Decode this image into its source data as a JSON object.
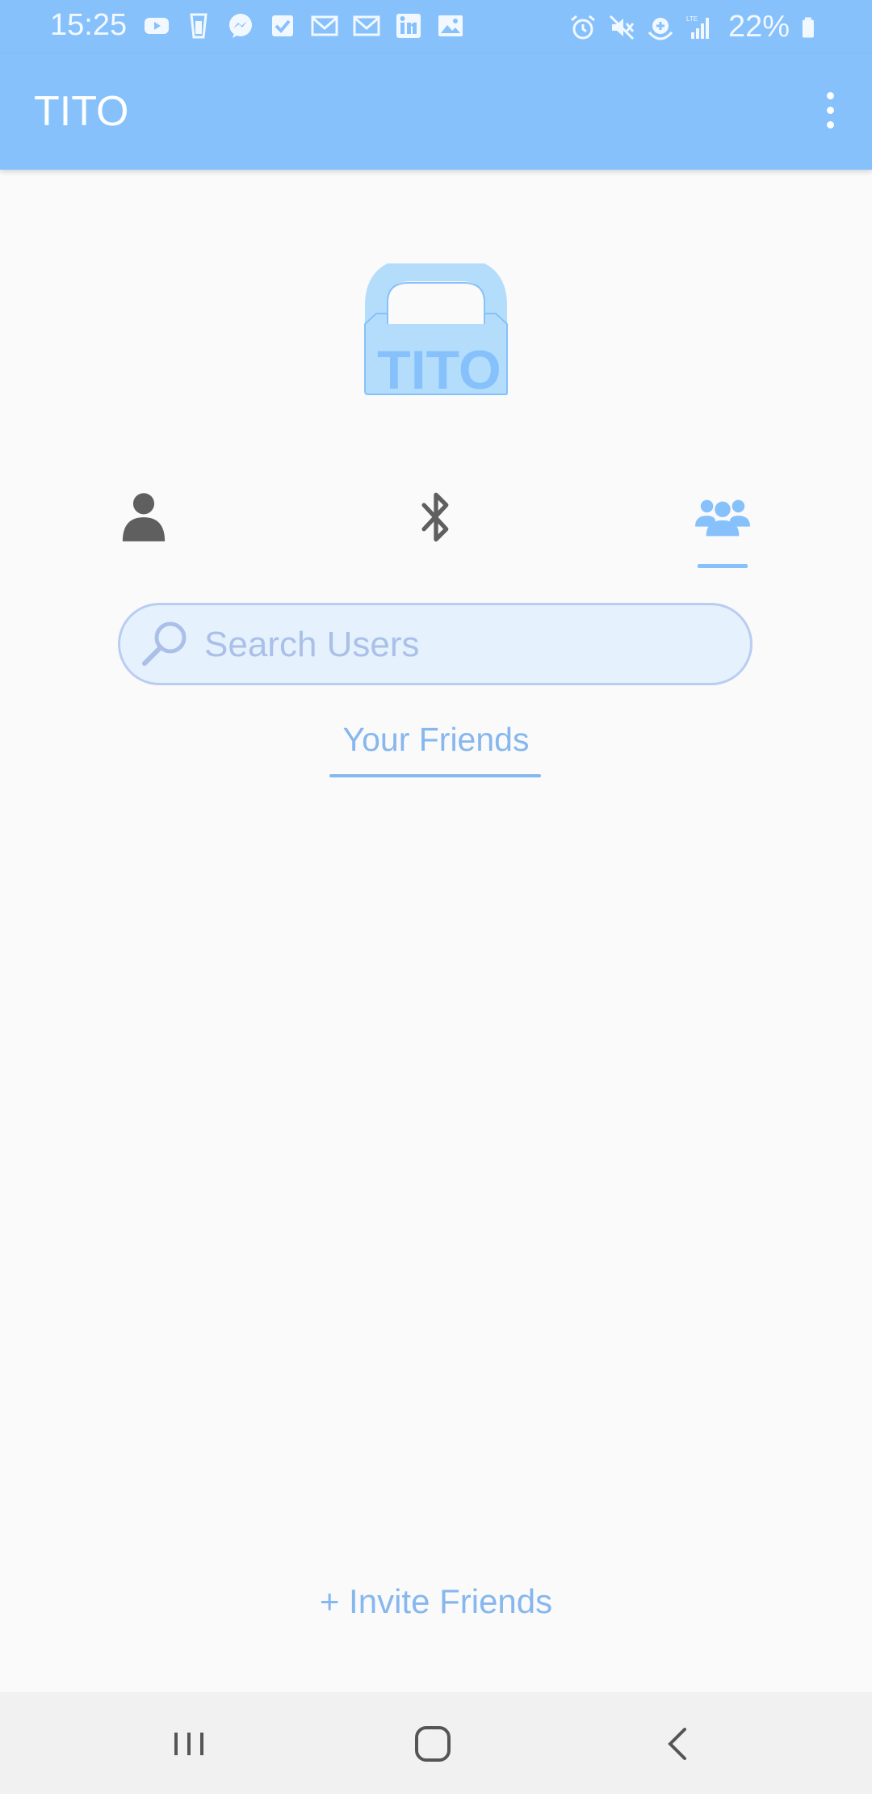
{
  "status_bar": {
    "time": "15:25",
    "battery": "22%",
    "notification_icons": [
      "youtube-icon",
      "glass-icon",
      "messenger-icon",
      "checkbox-icon",
      "gmail-icon",
      "gmail-icon",
      "linkedin-icon",
      "image-icon"
    ],
    "system_icons": [
      "alarm-icon",
      "mute-icon",
      "hotspot-icon",
      "lte-signal-icon",
      "battery-icon"
    ]
  },
  "app_bar": {
    "title": "TITO",
    "menu_icon": "more-vert-icon"
  },
  "logo": {
    "text": "TITO"
  },
  "tabs": [
    {
      "name": "profile",
      "icon": "person-icon",
      "selected": false
    },
    {
      "name": "bluetooth",
      "icon": "bluetooth-icon",
      "selected": false
    },
    {
      "name": "friends",
      "icon": "group-icon",
      "selected": true
    }
  ],
  "search": {
    "placeholder": "Search Users",
    "value": ""
  },
  "friends_section": {
    "title": "Your Friends"
  },
  "invite": {
    "label": "+ Invite Friends"
  },
  "colors": {
    "primary": "#86c1fc",
    "accent_text": "#86b7ee",
    "inactive_icon": "#5f5f5f",
    "background": "#fafafa"
  }
}
